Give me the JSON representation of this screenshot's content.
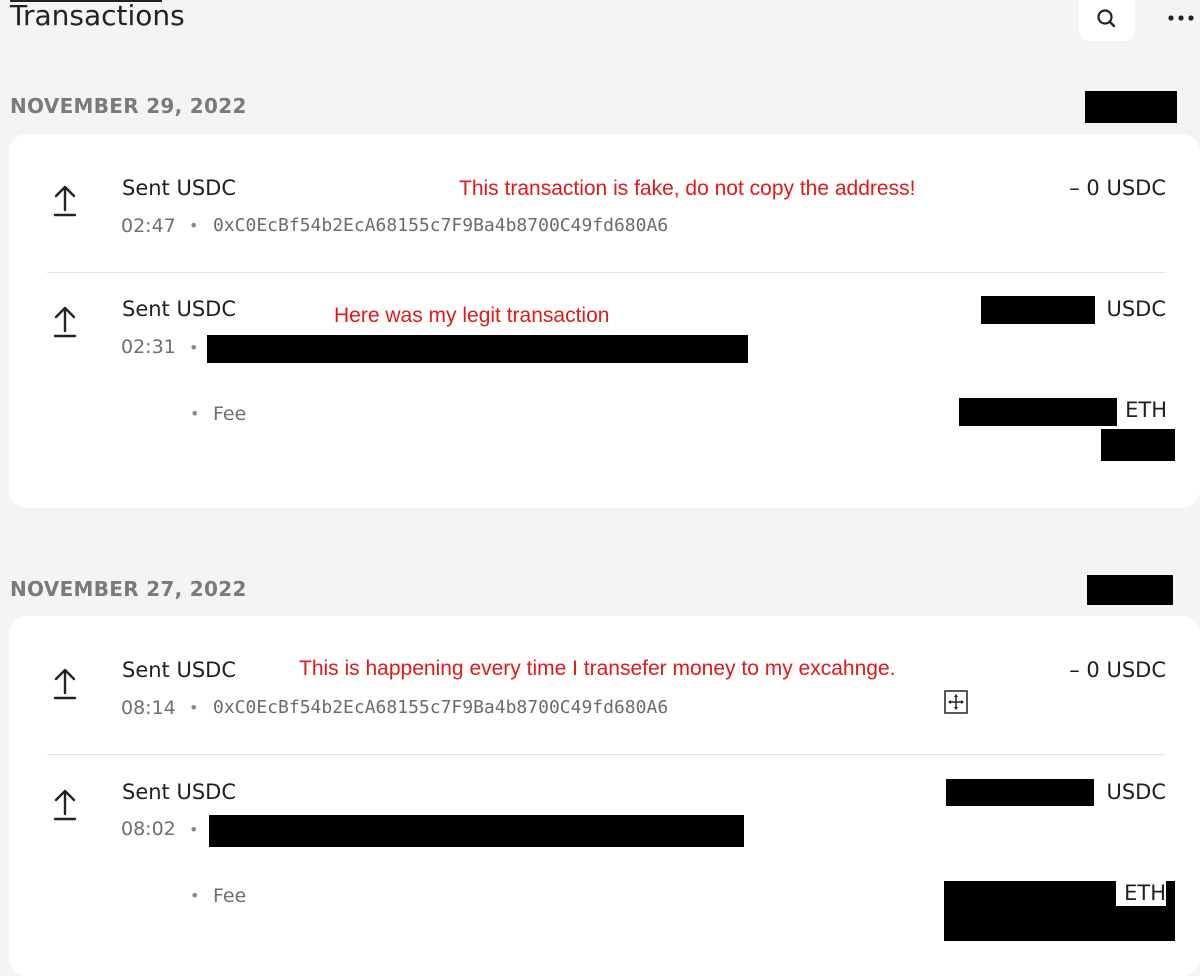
{
  "header": {
    "title": "Transactions",
    "search_icon": "search-icon",
    "more_icon": "more-horizontal-icon"
  },
  "groups": [
    {
      "date": "NOVEMBER 29, 2022",
      "transactions": [
        {
          "title": "Sent USDC",
          "time": "02:47",
          "dot": "•",
          "address": "0xC0EcBf54b2EcA68155c7F9Ba4b8700C49fd680A6",
          "amount": "– 0 USDC",
          "annotation": "This transaction is fake, do not copy the address!"
        },
        {
          "title": "Sent USDC",
          "time": "02:31",
          "dot": "•",
          "amount_unit": "USDC",
          "annotation": "Here was my legit transaction",
          "fee_dot": "•",
          "fee_label": "Fee",
          "fee_unit": "ETH"
        }
      ]
    },
    {
      "date": "NOVEMBER 27, 2022",
      "transactions": [
        {
          "title": "Sent USDC",
          "time": "08:14",
          "dot": "•",
          "address": "0xC0EcBf54b2EcA68155c7F9Ba4b8700C49fd680A6",
          "amount": "– 0 USDC",
          "annotation": "This is happening every time I transefer money to my excahnge."
        },
        {
          "title": "Sent USDC",
          "time": "08:02",
          "dot": "•",
          "amount_unit": "USDC",
          "fee_dot": "•",
          "fee_label": "Fee",
          "fee_unit": "ETH"
        }
      ]
    }
  ],
  "icons": {
    "tx_icon": "arrow-up-bar-icon",
    "move_handle": "move-handle-icon"
  },
  "colors": {
    "page_bg": "#f4f4f4",
    "card_bg": "#ffffff",
    "annotation": "#e0191b",
    "muted": "#7a7a7a"
  }
}
